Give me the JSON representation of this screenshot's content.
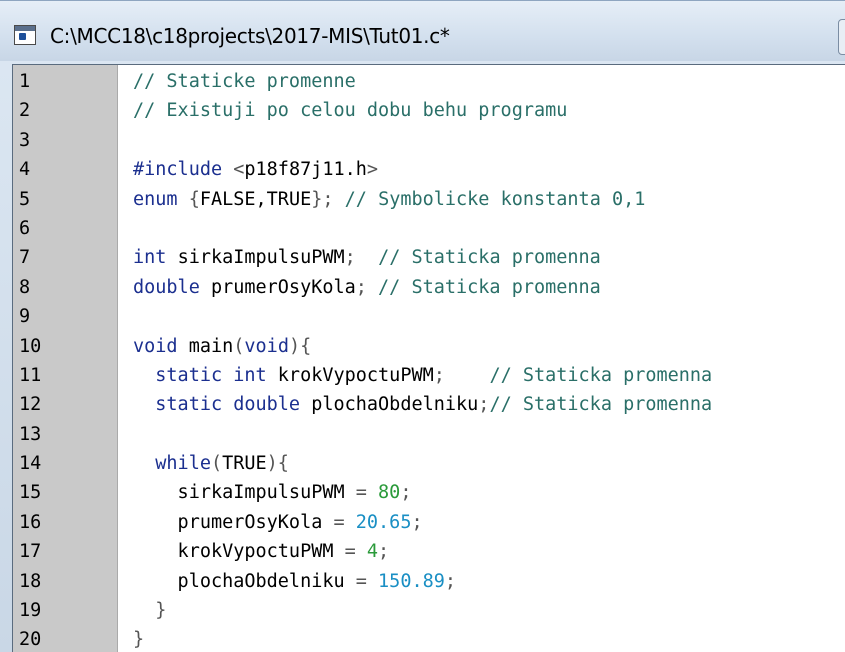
{
  "window": {
    "title": "C:\\MCC18\\c18projects\\2017-MIS\\Tut01.c*"
  },
  "editor": {
    "lines": [
      {
        "n": "1",
        "tokens": [
          {
            "t": "// Staticke promenne",
            "k": "cm"
          }
        ]
      },
      {
        "n": "2",
        "tokens": [
          {
            "t": "// Existuji po celou dobu behu programu",
            "k": "cm"
          }
        ]
      },
      {
        "n": "3",
        "tokens": []
      },
      {
        "n": "4",
        "tokens": [
          {
            "t": "#include ",
            "k": "pp"
          },
          {
            "t": "<",
            "k": "p"
          },
          {
            "t": "p18f87j11.h",
            "k": "id"
          },
          {
            "t": ">",
            "k": "p"
          }
        ]
      },
      {
        "n": "5",
        "tokens": [
          {
            "t": "enum ",
            "k": "kw"
          },
          {
            "t": "{",
            "k": "p"
          },
          {
            "t": "FALSE,TRUE",
            "k": "id"
          },
          {
            "t": "}; ",
            "k": "p"
          },
          {
            "t": "// Symbolicke konstanta 0,1",
            "k": "cm"
          }
        ]
      },
      {
        "n": "6",
        "tokens": []
      },
      {
        "n": "7",
        "tokens": [
          {
            "t": "int ",
            "k": "kw"
          },
          {
            "t": "sirkaImpulsuPWM",
            "k": "id"
          },
          {
            "t": ";  ",
            "k": "p"
          },
          {
            "t": "// Staticka promenna",
            "k": "cm"
          }
        ]
      },
      {
        "n": "8",
        "tokens": [
          {
            "t": "double ",
            "k": "kw"
          },
          {
            "t": "prumerOsyKola",
            "k": "id"
          },
          {
            "t": "; ",
            "k": "p"
          },
          {
            "t": "// Staticka promenna",
            "k": "cm"
          }
        ]
      },
      {
        "n": "9",
        "tokens": []
      },
      {
        "n": "10",
        "tokens": [
          {
            "t": "void ",
            "k": "kw"
          },
          {
            "t": "main",
            "k": "id"
          },
          {
            "t": "(",
            "k": "p"
          },
          {
            "t": "void",
            "k": "kw"
          },
          {
            "t": "){",
            "k": "p"
          }
        ]
      },
      {
        "n": "11",
        "tokens": [
          {
            "t": "  static int ",
            "k": "kw"
          },
          {
            "t": "krokVypoctuPWM",
            "k": "id"
          },
          {
            "t": ";    ",
            "k": "p"
          },
          {
            "t": "// Staticka promenna",
            "k": "cm"
          }
        ]
      },
      {
        "n": "12",
        "tokens": [
          {
            "t": "  static double ",
            "k": "kw"
          },
          {
            "t": "plochaObdelniku",
            "k": "id"
          },
          {
            "t": ";",
            "k": "p"
          },
          {
            "t": "// Staticka promenna",
            "k": "cm"
          }
        ]
      },
      {
        "n": "13",
        "tokens": []
      },
      {
        "n": "14",
        "tokens": [
          {
            "t": "  while",
            "k": "kw"
          },
          {
            "t": "(",
            "k": "p"
          },
          {
            "t": "TRUE",
            "k": "id"
          },
          {
            "t": "){",
            "k": "p"
          }
        ]
      },
      {
        "n": "15",
        "tokens": [
          {
            "t": "    sirkaImpulsuPWM ",
            "k": "id"
          },
          {
            "t": "= ",
            "k": "p"
          },
          {
            "t": "80",
            "k": "num"
          },
          {
            "t": ";",
            "k": "p"
          }
        ]
      },
      {
        "n": "16",
        "tokens": [
          {
            "t": "    prumerOsyKola ",
            "k": "id"
          },
          {
            "t": "= ",
            "k": "p"
          },
          {
            "t": "20.65",
            "k": "nb"
          },
          {
            "t": ";",
            "k": "p"
          }
        ]
      },
      {
        "n": "17",
        "tokens": [
          {
            "t": "    krokVypoctuPWM ",
            "k": "id"
          },
          {
            "t": "= ",
            "k": "p"
          },
          {
            "t": "4",
            "k": "num"
          },
          {
            "t": ";",
            "k": "p"
          }
        ]
      },
      {
        "n": "18",
        "tokens": [
          {
            "t": "    plochaObdelniku ",
            "k": "id"
          },
          {
            "t": "= ",
            "k": "p"
          },
          {
            "t": "150.89",
            "k": "nb"
          },
          {
            "t": ";",
            "k": "p"
          }
        ]
      },
      {
        "n": "19",
        "tokens": [
          {
            "t": "  }",
            "k": "p"
          }
        ]
      },
      {
        "n": "20",
        "tokens": [
          {
            "t": "}",
            "k": "p"
          }
        ]
      }
    ]
  },
  "colors": {
    "keyword": "#1b2f8f",
    "comment": "#2a6f68",
    "integer": "#2a9a3a",
    "float": "#1a8fc4",
    "gutter": "#c9c9c9"
  },
  "icons": {
    "app": "document-window-icon"
  }
}
